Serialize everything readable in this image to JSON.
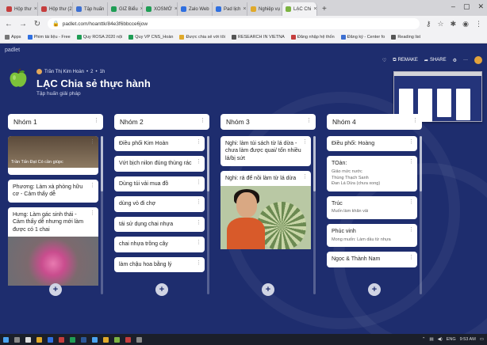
{
  "browser": {
    "tabs": [
      {
        "label": "Hộp thư",
        "color": "#c53d3d"
      },
      {
        "label": "Hộp thư (2)",
        "color": "#c53d3d"
      },
      {
        "label": "Tập huấn",
        "color": "#3c6fd1"
      },
      {
        "label": "GIZ Biểu",
        "color": "#1f9d55"
      },
      {
        "label": "XOSMỚ",
        "color": "#1f9d55"
      },
      {
        "label": "Zalo Web",
        "color": "#2f6fe0"
      },
      {
        "label": "Pad lịch",
        "color": "#2f6fe0"
      },
      {
        "label": "Nghiệp vụ",
        "color": "#e0a92a"
      },
      {
        "label": "LẠC Chi",
        "color": "#7cb342",
        "active": true
      }
    ],
    "new_tab": "+",
    "url": "padlet.com/hoanttk/84e3f6bbcce6jow",
    "bookmarks": [
      {
        "label": "Apps",
        "color": "#777"
      },
      {
        "label": "Phim tài liệu - Free",
        "color": "#2f6fe0"
      },
      {
        "label": "Quy ROSA 2020 nội",
        "color": "#1f9d55"
      },
      {
        "label": "Quy VP CNS_Hoàn",
        "color": "#1f9d55"
      },
      {
        "label": "Được chia sẻ với tôi",
        "color": "#e0a92a"
      },
      {
        "label": "RESEARCH IN VIETNA",
        "color": "#555"
      },
      {
        "label": "Đăng nhập hệ thốn",
        "color": "#c53d3d"
      },
      {
        "label": "Đăng ký - Center fo",
        "color": "#3c6fd1"
      },
      {
        "label": "Reading list",
        "color": "#555"
      }
    ]
  },
  "padlet": {
    "brand": "padlet",
    "author": "Trần Thị Kim Hoàn",
    "likes": "2",
    "time": "1h",
    "title": "LẠC Chia sẻ thực hành",
    "subtitle": "Tập huấn giải pháp",
    "toolbar": {
      "remake": "REMAKE",
      "share": "SHARE",
      "more": "···"
    }
  },
  "columns": [
    {
      "title": "Nhóm 1",
      "cards": [
        {
          "type": "image-top",
          "caption": "Trần Tấn Đạt Có cần giúpc"
        },
        {
          "text": "Phương: Làm xà phòng hữu cơ - Cảm thấy dễ"
        },
        {
          "text": "Hưng: Làm gác sinh thái - Cảm thấy dễ nhưng mới làm được có 1 chai",
          "photo": "pink"
        }
      ]
    },
    {
      "title": "Nhóm 2",
      "cards": [
        {
          "text": "Điều phối Kim Hoàn"
        },
        {
          "text": "Vứt bịch nilon đúng thùng rác"
        },
        {
          "text": "Dùng túi vải mua đồ"
        },
        {
          "text": "dùng vỏ đi chợ"
        },
        {
          "text": "tái sử dụng chai nhựa"
        },
        {
          "text": "chai nhựa trồng cây"
        },
        {
          "text": "làm chậu hoa bằng lý"
        }
      ]
    },
    {
      "title": "Nhóm 3",
      "cards": [
        {
          "text": "Nghi: làm túi sách từ lá dừa - chưa làm được quai/ tốn nhiều lá/bị sứt"
        },
        {
          "text": "Nghi: rá để nồi làm từ lá dừa",
          "photo": "person"
        }
      ]
    },
    {
      "title": "Nhóm 4",
      "cards": [
        {
          "text": "Điều phối: Hoàng"
        },
        {
          "text": "TOàn:",
          "sub": [
            "Giảo mức nước",
            "Thùng Thạch Sanh",
            "Đan Lá Dừa (chưa xong)"
          ]
        },
        {
          "text": "Trúc",
          "sub": [
            "Muốn làm khăn vải"
          ]
        },
        {
          "text": "Phúc vinh",
          "sub": [
            "Mong muốn: Làm dầu từ nhựa"
          ]
        },
        {
          "text": "Ngọc & Thành Nam"
        }
      ]
    }
  ],
  "add_label": "+",
  "taskbar": {
    "lang": "ENG",
    "time": "9:53 AM"
  }
}
